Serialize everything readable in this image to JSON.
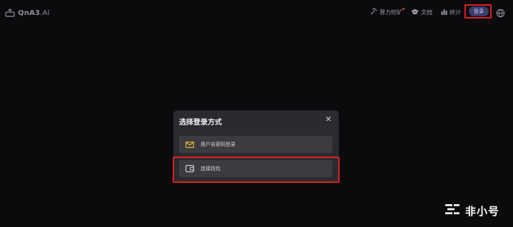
{
  "header": {
    "logo_brand": "QnA3",
    "logo_suffix": ".AI",
    "nav": [
      {
        "label": "算力挖矿",
        "icon": "pickaxe-icon"
      },
      {
        "label": "文档",
        "icon": "graduation-cap-icon"
      },
      {
        "label": "统计",
        "icon": "bar-chart-icon"
      }
    ],
    "login_label": "登录",
    "language_icon": "globe-icon"
  },
  "modal": {
    "title": "选择登录方式",
    "close_icon": "close-icon",
    "options": [
      {
        "label": "用户名密码登录",
        "icon": "mail-icon",
        "icon_color": "#e0b23a"
      },
      {
        "label": "连接钱包",
        "icon": "wallet-icon",
        "icon_color": "#d8d8d8"
      }
    ]
  },
  "watermark": {
    "text": "非小号"
  },
  "colors": {
    "background": "#0b0b0d",
    "modal": "#2a2b30",
    "option": "#3b3c41",
    "login_button": "#3a3c6a",
    "highlight": "#e02020"
  }
}
